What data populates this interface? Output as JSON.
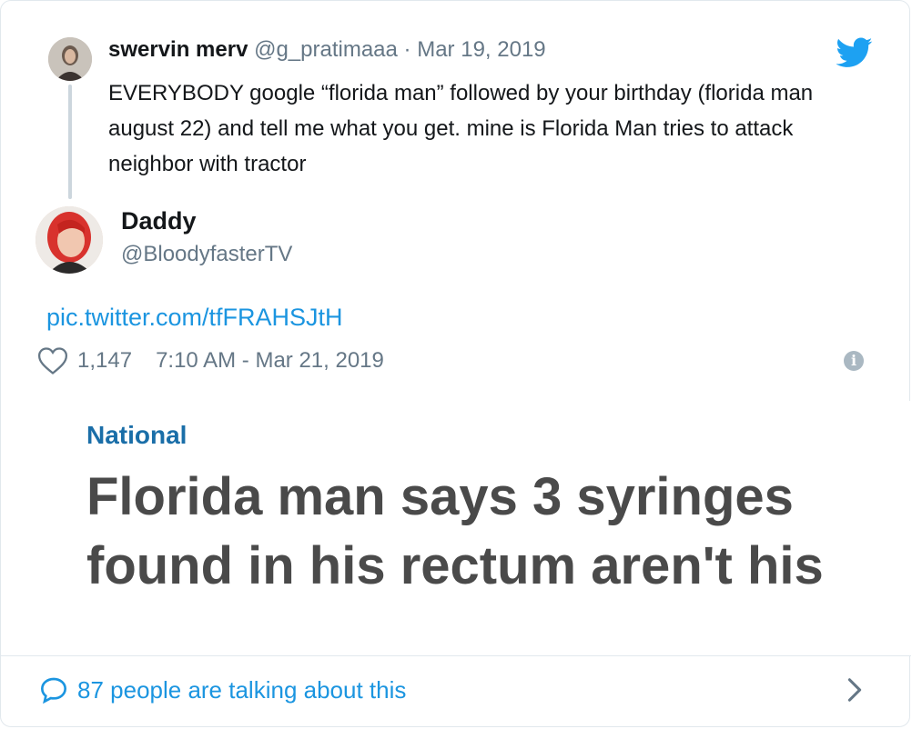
{
  "parent_tweet": {
    "display_name": "swervin merv",
    "handle": "@g_pratimaaa",
    "separator": "·",
    "date": "Mar 19, 2019",
    "text": "EVERYBODY google “florida man” followed by your birthday (florida man august 22) and tell me what you get. mine is Florida Man tries to attack neighbor with tractor"
  },
  "tweet": {
    "display_name": "Daddy",
    "handle": "@BloodyfasterTV",
    "link": "pic.twitter.com/tfFRAHSJtH",
    "like_count": "1,147",
    "timestamp": "7:10 AM - Mar 21, 2019",
    "info_glyph": "i"
  },
  "media": {
    "category": "National",
    "headline": "Florida man says 3 syringes found in his rectum aren't his"
  },
  "footer": {
    "talking": "87 people are talking about this"
  },
  "colors": {
    "link": "#1b95e0",
    "secondary_text": "#657786",
    "twitter_blue": "#1da1f2",
    "category": "#1a6ea8"
  },
  "icons": [
    "twitter-bird-icon",
    "heart-icon",
    "info-icon",
    "speech-bubble-icon",
    "chevron-right-icon"
  ]
}
